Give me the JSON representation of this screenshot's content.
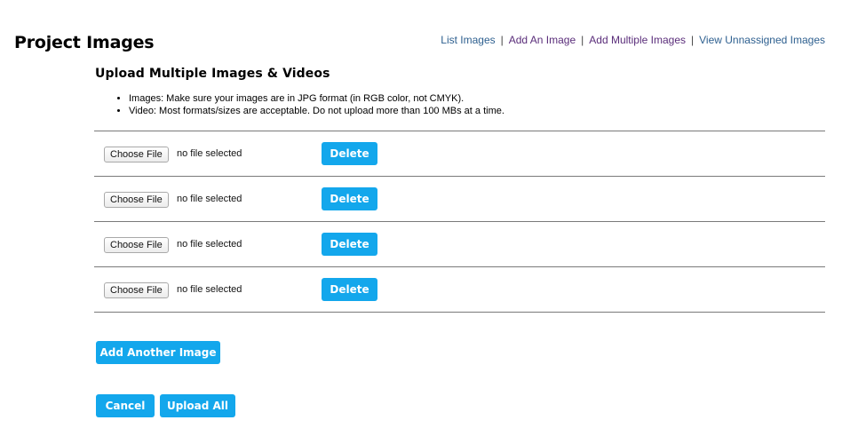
{
  "header": {
    "title": "Project Images"
  },
  "nav": {
    "items": [
      {
        "label": "List Images",
        "color": "#2d5f8f"
      },
      {
        "label": "Add An Image",
        "color": "#5a2d7a"
      },
      {
        "label": "Add Multiple Images",
        "color": "#5a2d7a"
      },
      {
        "label": "View Unnassigned Images",
        "color": "#2d5f8f"
      }
    ],
    "separator": "|"
  },
  "upload": {
    "title": "Upload Multiple Images & Videos",
    "instructions": [
      "Images: Make sure your images are in JPG format (in RGB color, not CMYK).",
      "Video: Most formats/sizes are acceptable. Do not upload more than 100 MBs at a time."
    ],
    "rows": [
      {
        "choose_label": "Choose File",
        "status": "no file selected",
        "delete_label": "Delete"
      },
      {
        "choose_label": "Choose File",
        "status": "no file selected",
        "delete_label": "Delete"
      },
      {
        "choose_label": "Choose File",
        "status": "no file selected",
        "delete_label": "Delete"
      },
      {
        "choose_label": "Choose File",
        "status": "no file selected",
        "delete_label": "Delete"
      }
    ]
  },
  "actions": {
    "add_another_label": "Add Another Image",
    "cancel_label": "Cancel",
    "upload_all_label": "Upload All"
  },
  "colors": {
    "accent": "#13a7ec"
  }
}
